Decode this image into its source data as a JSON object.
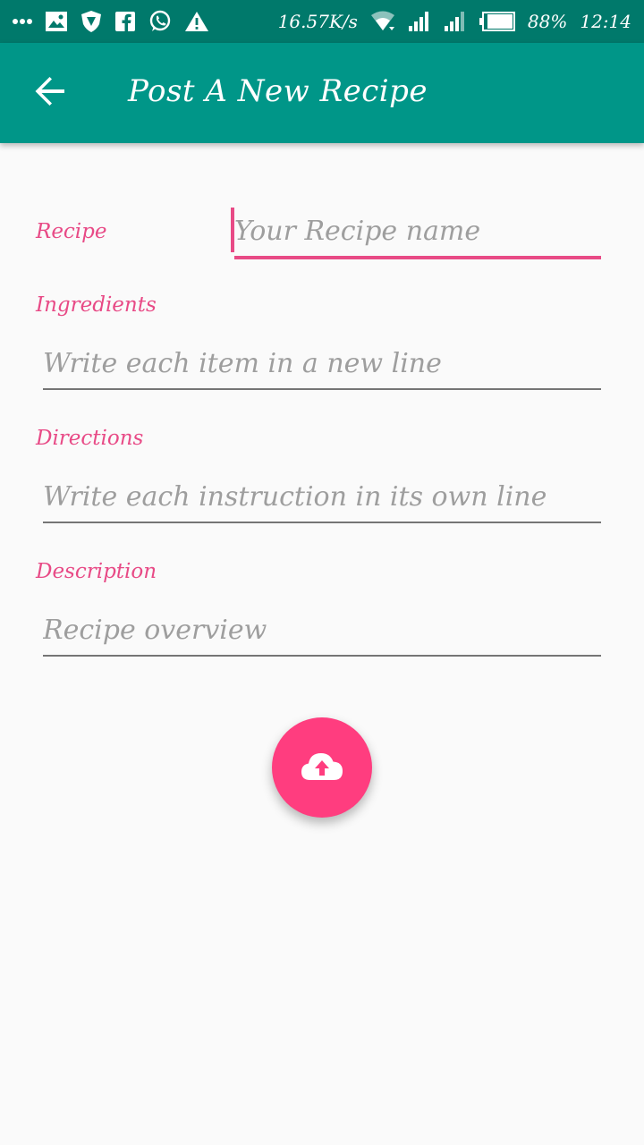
{
  "status_bar": {
    "left_icons": [
      "more-horizontal-icon",
      "image-icon",
      "vpn-shield-icon",
      "facebook-icon",
      "whatsapp-icon",
      "warning-icon"
    ],
    "net_speed": "16.57K/s",
    "battery": "88%",
    "time": "12:14"
  },
  "app_bar": {
    "title": "Post A New Recipe",
    "back_icon": "arrow-back-icon",
    "background": "#009688"
  },
  "form": {
    "recipe": {
      "label": "Recipe",
      "placeholder": "Your Recipe name",
      "value": ""
    },
    "ingredients": {
      "label": "Ingredients",
      "placeholder": "Write each item in a new line",
      "value": ""
    },
    "directions": {
      "label": "Directions",
      "placeholder": "Write each instruction in its own line",
      "value": ""
    },
    "description": {
      "label": "Description",
      "placeholder": "Recipe overview",
      "value": ""
    }
  },
  "fab": {
    "icon": "cloud-upload-icon",
    "color": "#ff3d7f"
  },
  "colors": {
    "accent": "#e84a86",
    "status_bar": "#00796b"
  }
}
